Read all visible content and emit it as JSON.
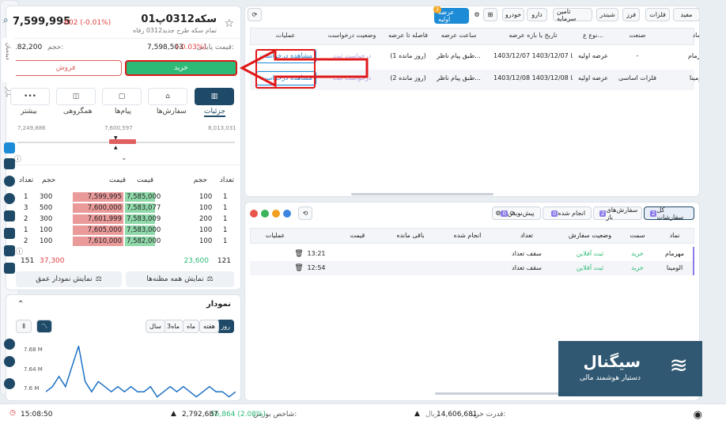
{
  "symbol": {
    "name": "سکه0312پ01",
    "fullname": "تمام سکه طرح جدید0312 رفاه",
    "price": "7,599,995",
    "change": "-602 (-0.01%)",
    "final_label": "قیمت پایانی:",
    "final_price": "7,598,503",
    "final_change": "(-0.03%)",
    "volume_label": "حجم:",
    "volume": "182,200"
  },
  "actions": {
    "buy": "خرید",
    "sell": "فروش"
  },
  "tabs": [
    {
      "label": "جزئیات"
    },
    {
      "label": "سفارش‌ها"
    },
    {
      "label": "پیام‌ها"
    },
    {
      "label": "همگروهی"
    },
    {
      "label": "بیشتر"
    }
  ],
  "range": {
    "low": "7,249,886",
    "mid": "7,600,597",
    "high": "8,013,031"
  },
  "orderbook": {
    "headers": {
      "count": "تعداد",
      "volume": "حجم",
      "price": "قیمت"
    },
    "rows": [
      {
        "bc": "1",
        "bv": "100",
        "bp": "7,585,000",
        "sp": "7,599,995",
        "sv": "300",
        "sc": "1"
      },
      {
        "bc": "1",
        "bv": "100",
        "bp": "7,583,077",
        "sp": "7,600,000",
        "sv": "500",
        "sc": "3"
      },
      {
        "bc": "1",
        "bv": "200",
        "bp": "7,583,009",
        "sp": "7,601,999",
        "sv": "300",
        "sc": "2"
      },
      {
        "bc": "1",
        "bv": "100",
        "bp": "7,583,000",
        "sp": "7,605,000",
        "sv": "100",
        "sc": "1"
      },
      {
        "bc": "1",
        "bv": "100",
        "bp": "7,582,000",
        "sp": "7,610,000",
        "sv": "100",
        "sc": "2"
      }
    ],
    "total_buy_count": "121",
    "total_buy_vol": "23,600",
    "total_sell_vol": "37,300",
    "total_sell_count": "151",
    "show_all": "نمایش همه مظنه‌ها",
    "show_depth": "نمایش نمودار عمق"
  },
  "chart": {
    "title": "نمودار",
    "ranges": [
      "روز",
      "هفته",
      "ماه",
      "3ماه",
      "سال"
    ],
    "yticks": [
      "7.68 M",
      "7.64 M",
      "7.6 M"
    ]
  },
  "chart_data": {
    "type": "line",
    "series": [
      {
        "values": [
          7.6,
          7.61,
          7.63,
          7.61,
          7.65,
          7.69,
          7.62,
          7.6,
          7.62,
          7.61,
          7.6,
          7.61,
          7.6,
          7.61,
          7.6,
          7.6,
          7.61,
          7.59,
          7.6,
          7.61,
          7.6,
          7.61,
          7.6,
          7.59,
          7.6,
          7.61,
          7.6,
          7.6,
          7.59,
          7.6
        ]
      }
    ],
    "ylim": [
      7.58,
      7.7
    ]
  },
  "ipo": {
    "filters": [
      "مفید",
      "فلزات",
      "فرز",
      "شبندر",
      "تامین سرمایه",
      "دارو",
      "خودرو"
    ],
    "active": "عرضه اولیه",
    "badge": "3",
    "headers": [
      "نماد",
      "صنعت",
      "نوع ع...",
      "تاریخ یا بازه عرضه",
      "ساعت عرضه",
      "فاصله تا عرضه",
      "وضعیت درخواست",
      "عملیات"
    ],
    "rows": [
      {
        "symbol": "مهرمام",
        "industry": "-",
        "type": "عرضه اولیه",
        "date": "1403/12/07 تا 1403/12/07",
        "time": "طبق پیام ناظر...",
        "remaining": "(1 روز مانده)",
        "status": "درخواست ثبت",
        "op": "مشاهده درخواست"
      },
      {
        "symbol": "الومینا",
        "industry": "فلزات اساسی",
        "type": "عرضه اولیه",
        "date": "1403/12/08 تا 1403/12/08",
        "time": "طبق پیام ناظر...",
        "remaining": "(2 روز مانده)",
        "status": "درخواست ثبت",
        "op": "مشاهده درخواست"
      }
    ]
  },
  "orders": {
    "tabs": [
      {
        "label": "کل سفارشات",
        "n": "2"
      },
      {
        "label": "سفارش‌های باز",
        "n": "2"
      },
      {
        "label": "انجام شده",
        "n": "0"
      },
      {
        "label": "پیش‌نویس",
        "n": "0"
      }
    ],
    "headers": [
      "نماد",
      "سمت",
      "وضعیت سفارش",
      "تعداد",
      "انجام شده",
      "باقی مانده",
      "قیمت",
      "",
      "عملیات"
    ],
    "rows": [
      {
        "symbol": "مهرمام",
        "side": "خرید",
        "status": "ثبت آفلاین",
        "count": "سقف تعداد",
        "time": "13:21"
      },
      {
        "symbol": "الومینا",
        "side": "خرید",
        "status": "ثبت آفلاین",
        "count": "سقف تعداد",
        "time": "12:54"
      }
    ]
  },
  "bottom": {
    "credit_label": "قدرت خرید:",
    "credit": "14,606,681",
    "unit": "ریال",
    "index_label": "شاخص بورس:",
    "index": "2,792,687",
    "index_change": "56,864 (2.08%)",
    "time": "15:08:50"
  },
  "watermark": {
    "brand": "سیگنال",
    "tag": "دستیار هوشمند مالی"
  },
  "sidebar": {
    "label1": "دیده‌بان",
    "label2": "بازار"
  },
  "colors": {
    "buy": "#2dba76",
    "sell": "#e06060",
    "accent": "#1d8bd6",
    "arrow": "#e01818"
  }
}
